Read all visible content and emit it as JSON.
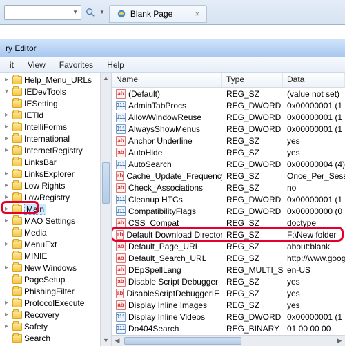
{
  "browser": {
    "tab_title": "Blank Page"
  },
  "editor": {
    "title_fragment": "ry Editor",
    "menu": {
      "edit": "it",
      "view": "View",
      "favorites": "Favorites",
      "help": "Help"
    }
  },
  "columns": {
    "name": "Name",
    "type": "Type",
    "data": "Data"
  },
  "tree": [
    {
      "label": "Help_Menu_URLs",
      "exp": "closed"
    },
    {
      "label": "IEDevTools",
      "exp": "open"
    },
    {
      "label": "IESetting",
      "exp": "none"
    },
    {
      "label": "IETld",
      "exp": "closed"
    },
    {
      "label": "IntelliForms",
      "exp": "closed"
    },
    {
      "label": "International",
      "exp": "closed"
    },
    {
      "label": "InternetRegistry",
      "exp": "closed"
    },
    {
      "label": "LinksBar",
      "exp": "none"
    },
    {
      "label": "LinksExplorer",
      "exp": "closed"
    },
    {
      "label": "Low Rights",
      "exp": "closed"
    },
    {
      "label": "LowRegistry",
      "exp": "closed"
    },
    {
      "label": "Main",
      "exp": "closed",
      "selected": true,
      "highlight": true
    },
    {
      "label": "MAO Settings",
      "exp": "closed"
    },
    {
      "label": "Media",
      "exp": "none"
    },
    {
      "label": "MenuExt",
      "exp": "closed"
    },
    {
      "label": "MINIE",
      "exp": "none"
    },
    {
      "label": "New Windows",
      "exp": "closed"
    },
    {
      "label": "PageSetup",
      "exp": "none"
    },
    {
      "label": "PhishingFilter",
      "exp": "none"
    },
    {
      "label": "ProtocolExecute",
      "exp": "closed"
    },
    {
      "label": "Recovery",
      "exp": "closed"
    },
    {
      "label": "Safety",
      "exp": "closed"
    },
    {
      "label": "Search",
      "exp": "none"
    }
  ],
  "values": [
    {
      "name": "(Default)",
      "type": "REG_SZ",
      "data": "(value not set)",
      "kind": "sz"
    },
    {
      "name": "AdminTabProcs",
      "type": "REG_DWORD",
      "data": "0x00000001 (1",
      "kind": "bin"
    },
    {
      "name": "AllowWindowReuse",
      "type": "REG_DWORD",
      "data": "0x00000001 (1",
      "kind": "bin"
    },
    {
      "name": "AlwaysShowMenus",
      "type": "REG_DWORD",
      "data": "0x00000001 (1",
      "kind": "bin"
    },
    {
      "name": "Anchor Underline",
      "type": "REG_SZ",
      "data": "yes",
      "kind": "sz"
    },
    {
      "name": "AutoHide",
      "type": "REG_SZ",
      "data": "yes",
      "kind": "sz"
    },
    {
      "name": "AutoSearch",
      "type": "REG_DWORD",
      "data": "0x00000004 (4)",
      "kind": "bin"
    },
    {
      "name": "Cache_Update_Frequency",
      "type": "REG_SZ",
      "data": "Once_Per_Session",
      "kind": "sz"
    },
    {
      "name": "Check_Associations",
      "type": "REG_SZ",
      "data": "no",
      "kind": "sz"
    },
    {
      "name": "Cleanup HTCs",
      "type": "REG_DWORD",
      "data": "0x00000001 (1",
      "kind": "bin"
    },
    {
      "name": "CompatibilityFlags",
      "type": "REG_DWORD",
      "data": "0x00000000 (0",
      "kind": "bin"
    },
    {
      "name": "CSS_Compat",
      "type": "REG_SZ",
      "data": "doctype",
      "kind": "sz"
    },
    {
      "name": "Default Download Directory",
      "type": "REG_SZ",
      "data": "F:\\New folder",
      "kind": "sz",
      "highlight": true
    },
    {
      "name": "Default_Page_URL",
      "type": "REG_SZ",
      "data": "about:blank",
      "kind": "sz"
    },
    {
      "name": "Default_Search_URL",
      "type": "REG_SZ",
      "data": "http://www.goog",
      "kind": "sz"
    },
    {
      "name": "DEpSpellLang",
      "type": "REG_MULTI_SZ",
      "data": "en-US",
      "kind": "sz"
    },
    {
      "name": "Disable Script Debugger",
      "type": "REG_SZ",
      "data": "yes",
      "kind": "sz"
    },
    {
      "name": "DisableScriptDebuggerIE",
      "type": "REG_SZ",
      "data": "yes",
      "kind": "sz"
    },
    {
      "name": "Display Inline Images",
      "type": "REG_SZ",
      "data": "yes",
      "kind": "sz"
    },
    {
      "name": "Display Inline Videos",
      "type": "REG_DWORD",
      "data": "0x00000001 (1",
      "kind": "bin"
    },
    {
      "name": "Do404Search",
      "type": "REG_BINARY",
      "data": "01 00 00 00",
      "kind": "bin"
    }
  ],
  "icon_text": {
    "sz": "ab",
    "bin": "011"
  }
}
